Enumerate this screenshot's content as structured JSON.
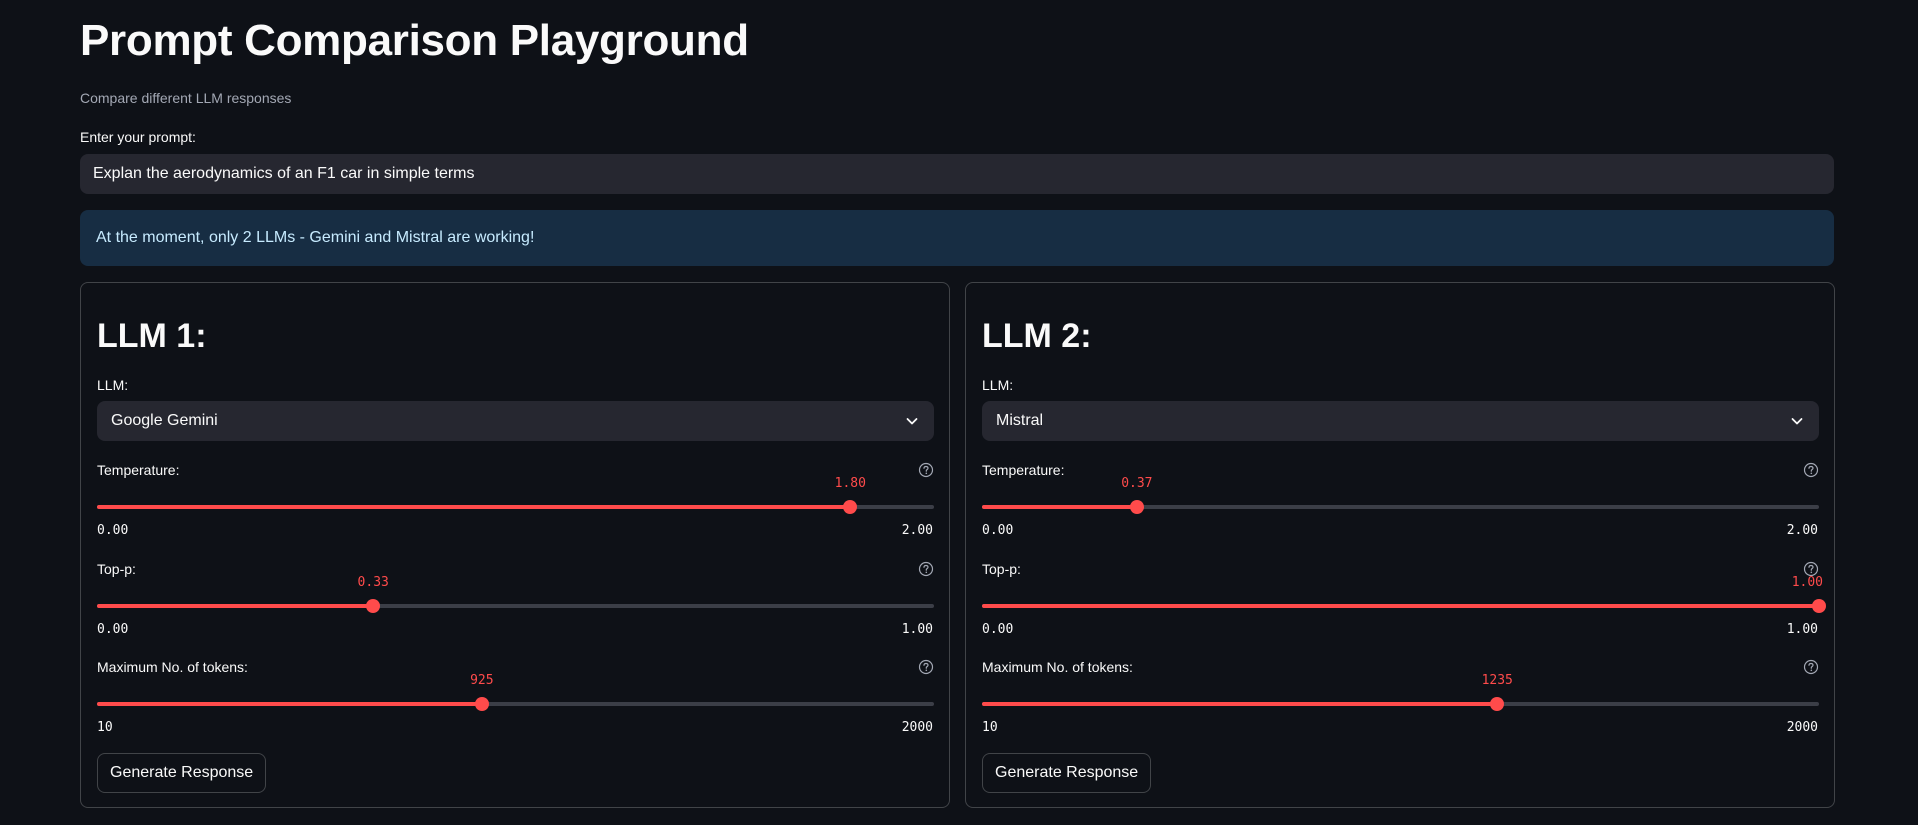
{
  "page": {
    "title": "Prompt Comparison Playground",
    "subtitle": "Compare different LLM responses"
  },
  "prompt": {
    "label": "Enter your prompt:",
    "value": "Explan the aerodynamics of an F1 car in simple terms"
  },
  "alert": {
    "message": "At the moment, only 2 LLMs - Gemini and Mistral are working!"
  },
  "colors": {
    "background": "#0e1117",
    "accent": "#ff4b4b",
    "input_bg": "#262730",
    "info_bg": "#172d43",
    "info_text": "#c7ebff"
  },
  "columns": [
    {
      "heading": "LLM 1:",
      "llm_label": "LLM:",
      "llm_value": "Google Gemini",
      "sliders": [
        {
          "label": "Temperature:",
          "value": 1.8,
          "display": "1.80",
          "min": 0,
          "max": 2,
          "min_label": "0.00",
          "max_label": "2.00",
          "help_icon": "question-circle-icon"
        },
        {
          "label": "Top-p:",
          "value": 0.33,
          "display": "0.33",
          "min": 0,
          "max": 1,
          "min_label": "0.00",
          "max_label": "1.00",
          "help_icon": "question-circle-icon"
        },
        {
          "label": "Maximum No. of tokens:",
          "value": 925,
          "display": "925",
          "min": 10,
          "max": 2000,
          "min_label": "10",
          "max_label": "2000",
          "help_icon": "question-circle-icon"
        }
      ],
      "button_label": "Generate Response"
    },
    {
      "heading": "LLM 2:",
      "llm_label": "LLM:",
      "llm_value": "Mistral",
      "sliders": [
        {
          "label": "Temperature:",
          "value": 0.37,
          "display": "0.37",
          "min": 0,
          "max": 2,
          "min_label": "0.00",
          "max_label": "2.00",
          "help_icon": "question-circle-icon"
        },
        {
          "label": "Top-p:",
          "value": 1.0,
          "display": "1.00",
          "min": 0,
          "max": 1,
          "min_label": "0.00",
          "max_label": "1.00",
          "help_icon": "question-circle-icon"
        },
        {
          "label": "Maximum No. of tokens:",
          "value": 1235,
          "display": "1235",
          "min": 10,
          "max": 2000,
          "min_label": "10",
          "max_label": "2000",
          "help_icon": "question-circle-icon"
        }
      ],
      "button_label": "Generate Response"
    }
  ]
}
